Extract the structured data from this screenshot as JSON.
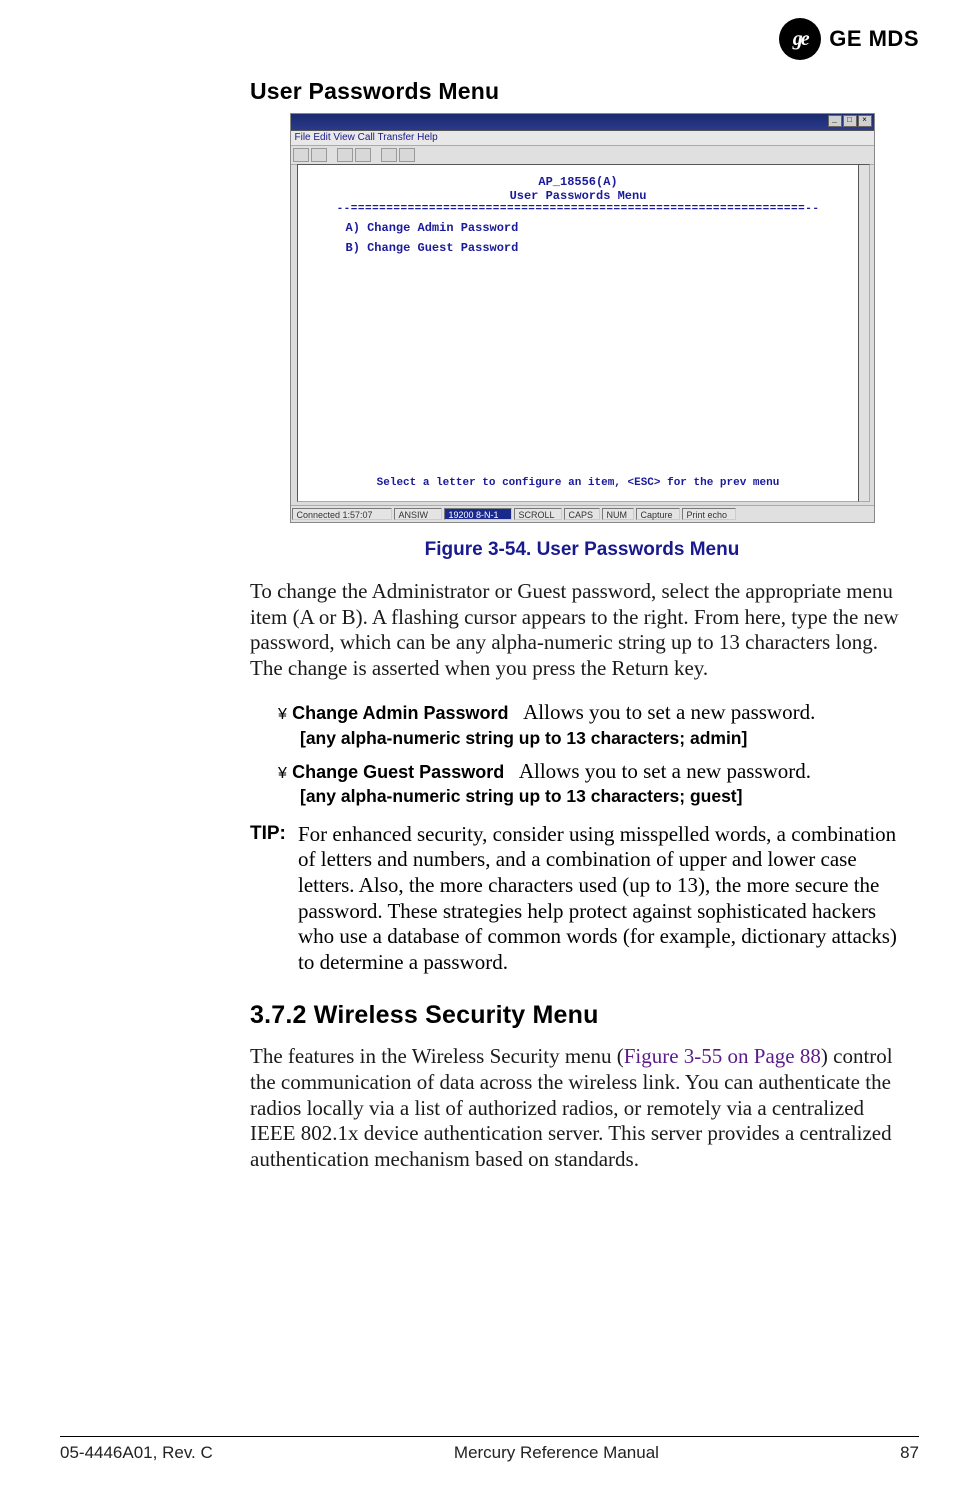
{
  "header": {
    "ge_glyph": "ge",
    "brand_text": "GE MDS"
  },
  "section": {
    "title": "User Passwords Menu"
  },
  "figure": {
    "caption": "Figure 3-54. User Passwords Menu",
    "window": {
      "menubar": "File  Edit  View  Call  Transfer  Help",
      "terminal": {
        "device_line": "AP_18556(A)",
        "title_line": "User Passwords Menu",
        "divider": "--================================================================--",
        "item_a": "A) Change Admin Password",
        "item_b": "B) Change Guest Password",
        "hint": "Select a letter to configure an item, <ESC> for the prev menu"
      },
      "status": {
        "c0": "Connected 1:57:07",
        "c1": "ANSIW",
        "c2": "19200 8-N-1",
        "c3": "SCROLL",
        "c4": "CAPS",
        "c5": "NUM",
        "c6": "Capture",
        "c7": "Print echo"
      }
    }
  },
  "body": {
    "intro": "To change the Administrator or Guest password, select the appropriate menu item (A or B). A flashing cursor appears to the right. From here, type the new password, which can be any alpha-numeric string up to 13 characters long. The change is asserted when you press the Return key.",
    "params": [
      {
        "bullet": "¥",
        "name": "Change Admin Password",
        "desc": "Allows you to set a new password.",
        "range": "[any alpha-numeric string up to 13 characters; admin]"
      },
      {
        "bullet": "¥",
        "name": "Change Guest Password",
        "desc": "Allows you to set a new password.",
        "range": "[any alpha-numeric string up to 13 characters; guest]"
      }
    ],
    "tip_label": "TIP:",
    "tip_text": "For enhanced security, consider using misspelled words, a combination of letters and numbers, and a combination of upper and lower case letters. Also, the more characters used (up to 13), the more secure the password. These strategies help protect against sophisticated hackers who use a database of common words (for example, dictionary attacks) to determine a password."
  },
  "subsection": {
    "number_title": "3.7.2 Wireless Security Menu",
    "intro_pre": "The features in the Wireless Security menu (",
    "xref": "Figure 3-55 on Page 88",
    "intro_post": ") control the communication of data across the wireless link. You can authenticate the radios locally via a list of authorized radios, or remotely via a centralized IEEE 802.1x device authentication server. This server provides a centralized authentication mechanism based on standards."
  },
  "footer": {
    "left": "05-4446A01, Rev. C",
    "center": "Mercury Reference Manual",
    "right": "87"
  }
}
